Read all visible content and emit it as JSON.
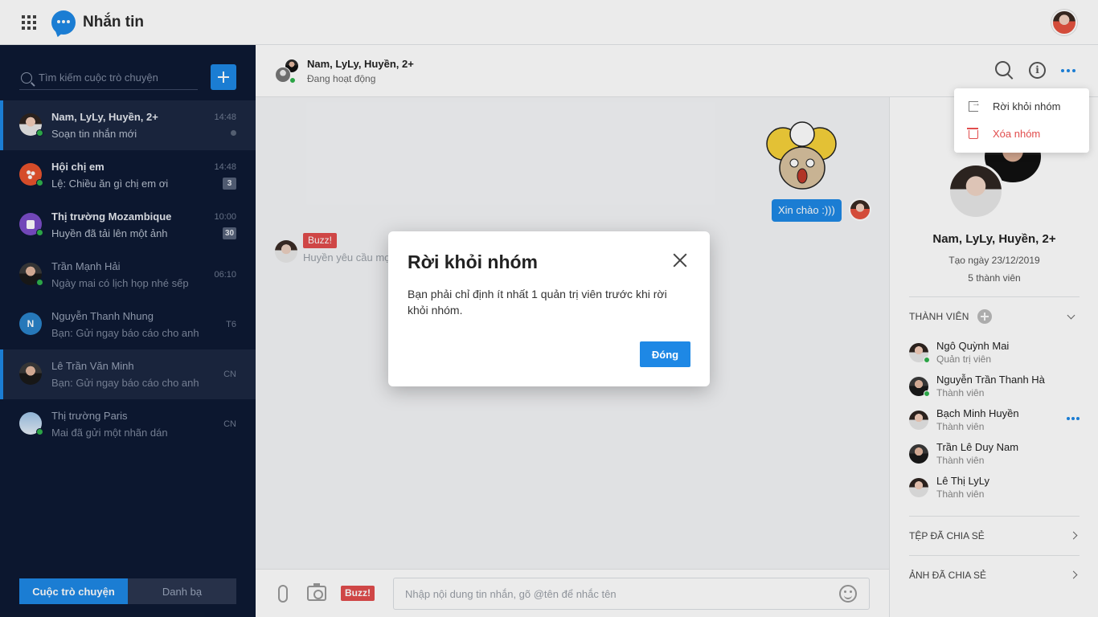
{
  "app": {
    "title": "Nhắn tin"
  },
  "search": {
    "placeholder": "Tìm kiếm cuộc trò chuyện"
  },
  "conversations": [
    {
      "name": "Nam, LyLy, Huyền, 2+",
      "message": "Soạn tin nhắn mới",
      "time": "14:48",
      "state": "active"
    },
    {
      "name": "Hội chị em",
      "message": "Lệ: Chiều ăn gì chị em ơi",
      "time": "14:48",
      "badge": "3"
    },
    {
      "name": "Thị trường Mozambique",
      "message": "Huyền đã tải lên một ảnh",
      "time": "10:00",
      "badge": "30"
    },
    {
      "name": "Trần Mạnh Hải",
      "message": "Ngày mai có lịch họp nhé sếp",
      "time": "06:10",
      "state": "dim"
    },
    {
      "name": "Nguyễn Thanh Nhung",
      "message": "Bạn: Gửi ngay báo cáo cho anh",
      "time": "T6",
      "state": "dim",
      "initial": "N"
    },
    {
      "name": "Lê Trần Văn Minh",
      "message": "Bạn: Gửi ngay báo cáo cho anh",
      "time": "CN",
      "state": "selected"
    },
    {
      "name": "Thị trường Paris",
      "message": "Mai đã gửi một nhãn dán",
      "time": "CN",
      "state": "dim"
    }
  ],
  "tabs": {
    "chats": "Cuộc trò chuyện",
    "contacts": "Danh bạ"
  },
  "chat": {
    "name": "Nam, LyLy, Huyền, 2+",
    "status": "Đang hoạt động",
    "outgoing_text": "Xin chào :)))",
    "buzz_label": "Buzz!",
    "buzz_note": "Huyền yêu cầu mọi người",
    "composer_placeholder": "Nhập nội dung tin nhắn, gõ @tên để nhắc tên"
  },
  "info": {
    "group_name": "Nam, LyLy, Huyền, 2+",
    "created": "Tạo ngày 23/12/2019",
    "member_count": "5 thành viên",
    "members_title": "THÀNH VIÊN",
    "members": [
      {
        "name": "Ngô Quỳnh Mai",
        "role": "Quản trị viên"
      },
      {
        "name": "Nguyễn Trần Thanh Hà",
        "role": "Thành viên"
      },
      {
        "name": "Bạch Minh Huyền",
        "role": "Thành viên"
      },
      {
        "name": "Trần Lê Duy Nam",
        "role": "Thành viên"
      },
      {
        "name": "Lê Thị LyLy",
        "role": "Thành viên"
      }
    ],
    "shared_files": "TỆP ĐÃ CHIA SẺ",
    "shared_images": "ẢNH ĐÃ CHIA SẺ"
  },
  "menu": {
    "leave": "Rời khỏi nhóm",
    "delete": "Xóa nhóm"
  },
  "dialog": {
    "title": "Rời khỏi nhóm",
    "body": "Bạn phải chỉ định ít nhất 1 quản trị viên trước khi rời khỏi nhóm.",
    "ok": "Đóng"
  },
  "colors": {
    "accent": "#1e88e5",
    "sidebar": "#0e1a33",
    "danger": "#e14d4d",
    "online": "#2fb24c"
  }
}
